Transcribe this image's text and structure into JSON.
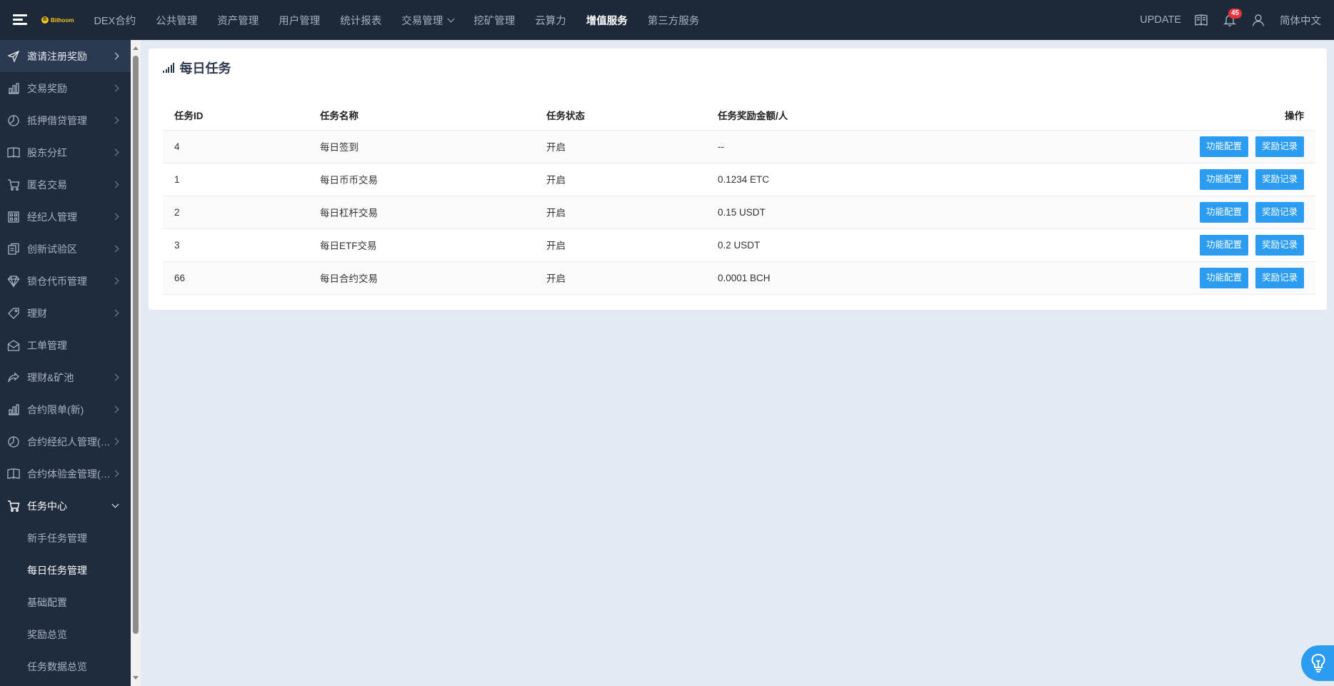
{
  "header": {
    "logo_text": "Bithoom",
    "nav": [
      {
        "label": "DEX合约"
      },
      {
        "label": "公共管理"
      },
      {
        "label": "资产管理"
      },
      {
        "label": "用户管理"
      },
      {
        "label": "统计报表"
      },
      {
        "label": "交易管理",
        "has_caret": true
      },
      {
        "label": "挖矿管理"
      },
      {
        "label": "云算力"
      },
      {
        "label": "增值服务",
        "active": true
      },
      {
        "label": "第三方服务"
      }
    ],
    "update_label": "UPDATE",
    "notification_count": "45",
    "language": "简体中文"
  },
  "sidebar": {
    "items": [
      {
        "label": "邀请注册奖励",
        "icon": "send-icon"
      },
      {
        "label": "交易奖励",
        "icon": "bar-chart-icon"
      },
      {
        "label": "抵押借贷管理",
        "icon": "pie-chart-icon"
      },
      {
        "label": "股东分红",
        "icon": "book-icon"
      },
      {
        "label": "匿名交易",
        "icon": "cart-icon"
      },
      {
        "label": "经纪人管理",
        "icon": "grid-icon"
      },
      {
        "label": "创新试验区",
        "icon": "copy-icon"
      },
      {
        "label": "锁仓代币管理",
        "icon": "diamond-icon"
      },
      {
        "label": "理财",
        "icon": "tag-icon"
      },
      {
        "label": "工单管理",
        "icon": "mail-icon"
      },
      {
        "label": "理财&矿池",
        "icon": "share-icon"
      },
      {
        "label": "合约限单(新)",
        "icon": "bar-chart-icon"
      },
      {
        "label": "合约经纪人管理(新)",
        "icon": "pie-chart-icon"
      },
      {
        "label": "合约体验金管理(新)",
        "icon": "book-icon"
      },
      {
        "label": "任务中心",
        "icon": "cart-icon"
      }
    ],
    "task_center_sub": [
      {
        "label": "新手任务管理"
      },
      {
        "label": "每日任务管理"
      },
      {
        "label": "基础配置"
      },
      {
        "label": "奖励总览"
      },
      {
        "label": "任务数据总览"
      }
    ]
  },
  "page": {
    "title": "每日任务",
    "table": {
      "columns": [
        "任务ID",
        "任务名称",
        "任务状态",
        "任务奖励金额/人",
        "操作"
      ],
      "rows": [
        {
          "id": "4",
          "name": "每日签到",
          "status": "开启",
          "reward": "--"
        },
        {
          "id": "1",
          "name": "每日币币交易",
          "status": "开启",
          "reward": "0.1234 ETC"
        },
        {
          "id": "2",
          "name": "每日杠杆交易",
          "status": "开启",
          "reward": "0.15 USDT"
        },
        {
          "id": "3",
          "name": "每日ETF交易",
          "status": "开启",
          "reward": "0.2 USDT"
        },
        {
          "id": "66",
          "name": "每日合约交易",
          "status": "开启",
          "reward": "0.0001 BCH"
        }
      ],
      "actions": {
        "config": "功能配置",
        "records": "奖励记录"
      }
    }
  },
  "colors": {
    "topbar": "#1d2838",
    "sidebar": "#1f2c3e",
    "accent": "#2b9cf0",
    "badge": "#e8323c",
    "background": "#e4eaf3"
  }
}
